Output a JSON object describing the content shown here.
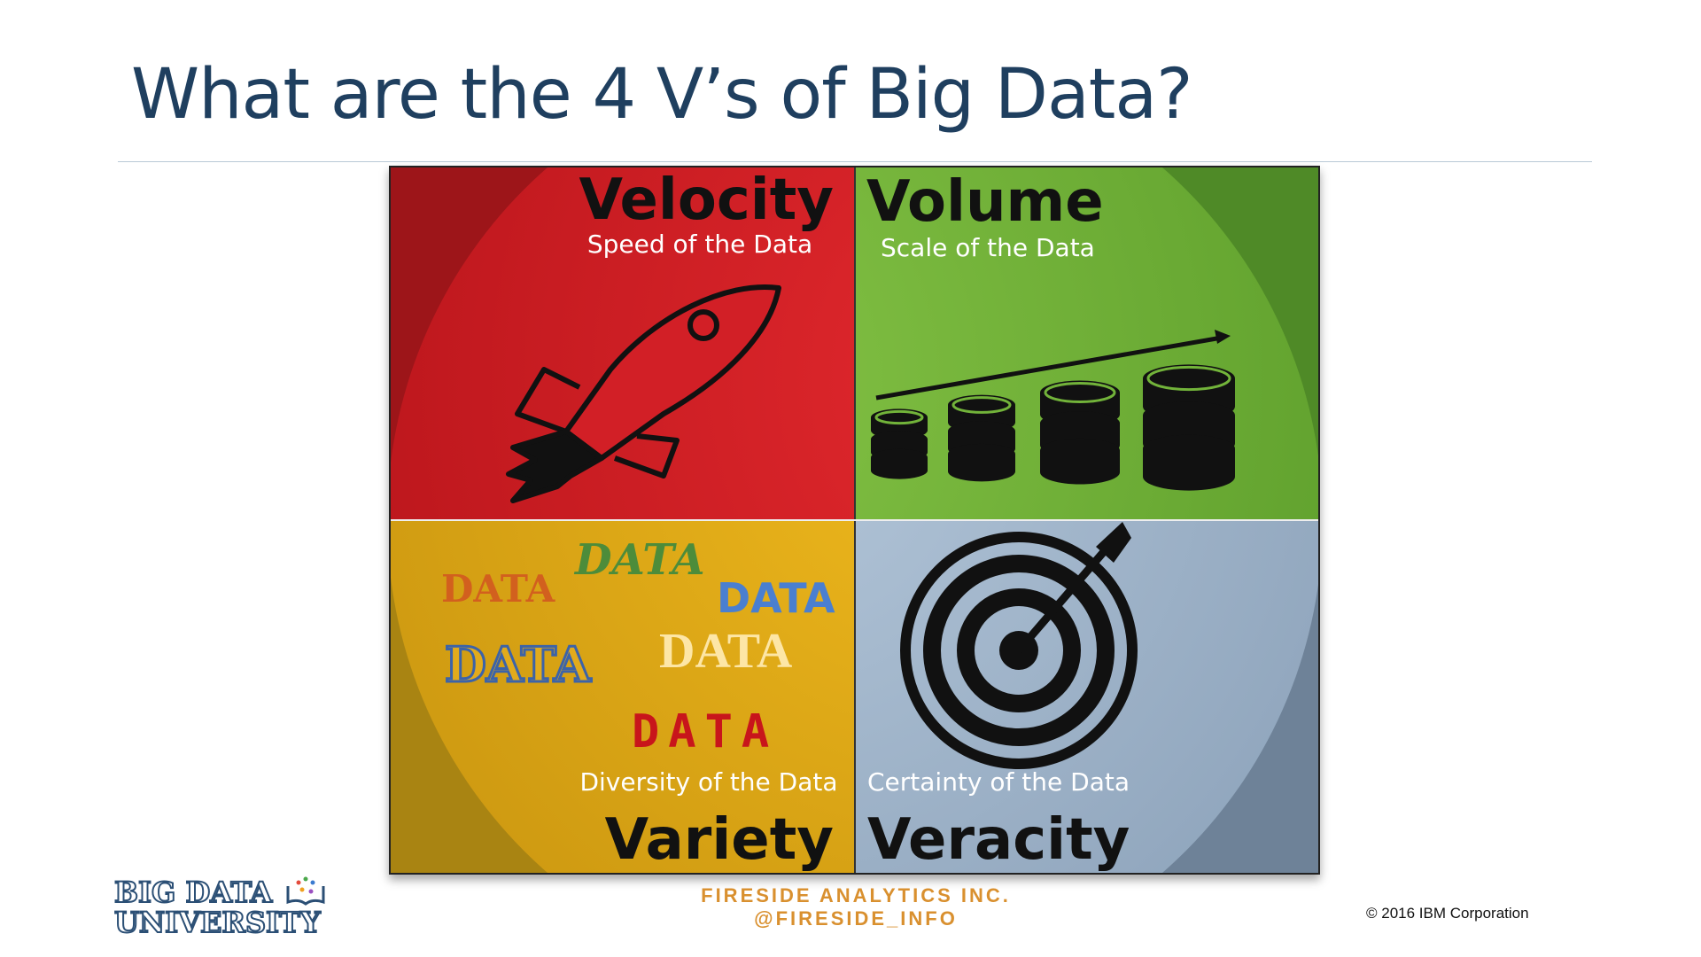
{
  "slide": {
    "title": "What are the 4 V’s of Big Data?"
  },
  "quadrants": {
    "velocity": {
      "title": "Velocity",
      "subtitle": "Speed of the Data",
      "icon": "rocket-icon",
      "color": "#d21f26"
    },
    "volume": {
      "title": "Volume",
      "subtitle": "Scale of the Data",
      "icon": "database-growth-icon",
      "color": "#72b33a"
    },
    "variety": {
      "title": "Variety",
      "subtitle": "Diversity of the Data",
      "icon": "data-words",
      "color": "#e3ad1a",
      "words": [
        "DATA",
        "DATA",
        "DATA",
        "DATA",
        "DATA",
        "DATA"
      ]
    },
    "veracity": {
      "title": "Veracity",
      "subtitle": "Certainty of the Data",
      "icon": "target-icon",
      "color": "#a3b7cc"
    }
  },
  "footer": {
    "logo_line1": "BIG DATA",
    "logo_line2": "UNIVERSITY",
    "company": "FIRESIDE ANALYTICS INC.",
    "handle": "@FIRESIDE_INFO",
    "copyright": "© 2016 IBM Corporation"
  }
}
